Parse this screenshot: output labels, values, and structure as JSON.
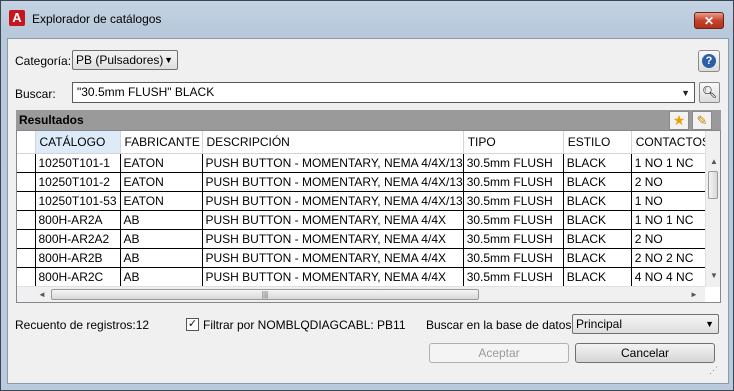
{
  "window": {
    "title": "Explorador de catálogos",
    "close_label": "✕"
  },
  "category": {
    "label": "Categoría:",
    "value": "PB (Pulsadores)"
  },
  "search": {
    "label": "Buscar:",
    "value": "\"30.5mm FLUSH\" BLACK"
  },
  "results": {
    "label": "Resultados",
    "columns": [
      "CATÁLOGO",
      "FABRICANTE",
      "DESCRIPCIÓN",
      "TIPO",
      "ESTILO",
      "CONTACTOS"
    ],
    "rows": [
      [
        "10250T101-1",
        "EATON",
        "PUSH BUTTON - MOMENTARY, NEMA 4/4X/13",
        "30.5mm FLUSH",
        "BLACK",
        "1 NO 1 NC"
      ],
      [
        "10250T101-2",
        "EATON",
        "PUSH BUTTON - MOMENTARY, NEMA 4/4X/13",
        "30.5mm FLUSH",
        "BLACK",
        "2 NO"
      ],
      [
        "10250T101-53",
        "EATON",
        "PUSH BUTTON - MOMENTARY, NEMA 4/4X/13",
        "30.5mm FLUSH",
        "BLACK",
        "1 NO"
      ],
      [
        "800H-AR2A",
        "AB",
        "PUSH BUTTON - MOMENTARY, NEMA 4/4X",
        "30.5mm FLUSH",
        "BLACK",
        "1 NO 1 NC"
      ],
      [
        "800H-AR2A2",
        "AB",
        "PUSH BUTTON - MOMENTARY, NEMA 4/4X",
        "30.5mm FLUSH",
        "BLACK",
        "2 NO"
      ],
      [
        "800H-AR2B",
        "AB",
        "PUSH BUTTON - MOMENTARY, NEMA 4/4X",
        "30.5mm FLUSH",
        "BLACK",
        "2 NO 2 NC"
      ],
      [
        "800H-AR2C",
        "AB",
        "PUSH BUTTON - MOMENTARY, NEMA 4/4X",
        "30.5mm FLUSH",
        "BLACK",
        "4 NO 4 NC"
      ]
    ]
  },
  "footer": {
    "record_count": "Recuento de registros:12",
    "filter_label": "Filtrar por NOMBLQDIAGCABL: PB11",
    "filter_checked": true,
    "db_label": "Buscar en la base de datos:",
    "db_value": "Principal",
    "accept_label": "Aceptar",
    "cancel_label": "Cancelar"
  },
  "icons": {
    "app": "autocad-icon",
    "help": "help-icon",
    "search": "magnifier-icon",
    "favorite": "star-icon",
    "edit": "pencil-icon"
  },
  "colors": {
    "accent": "#c6151d",
    "header_bar": "#9a9a9a",
    "selected_column": "#ddeaf7"
  }
}
